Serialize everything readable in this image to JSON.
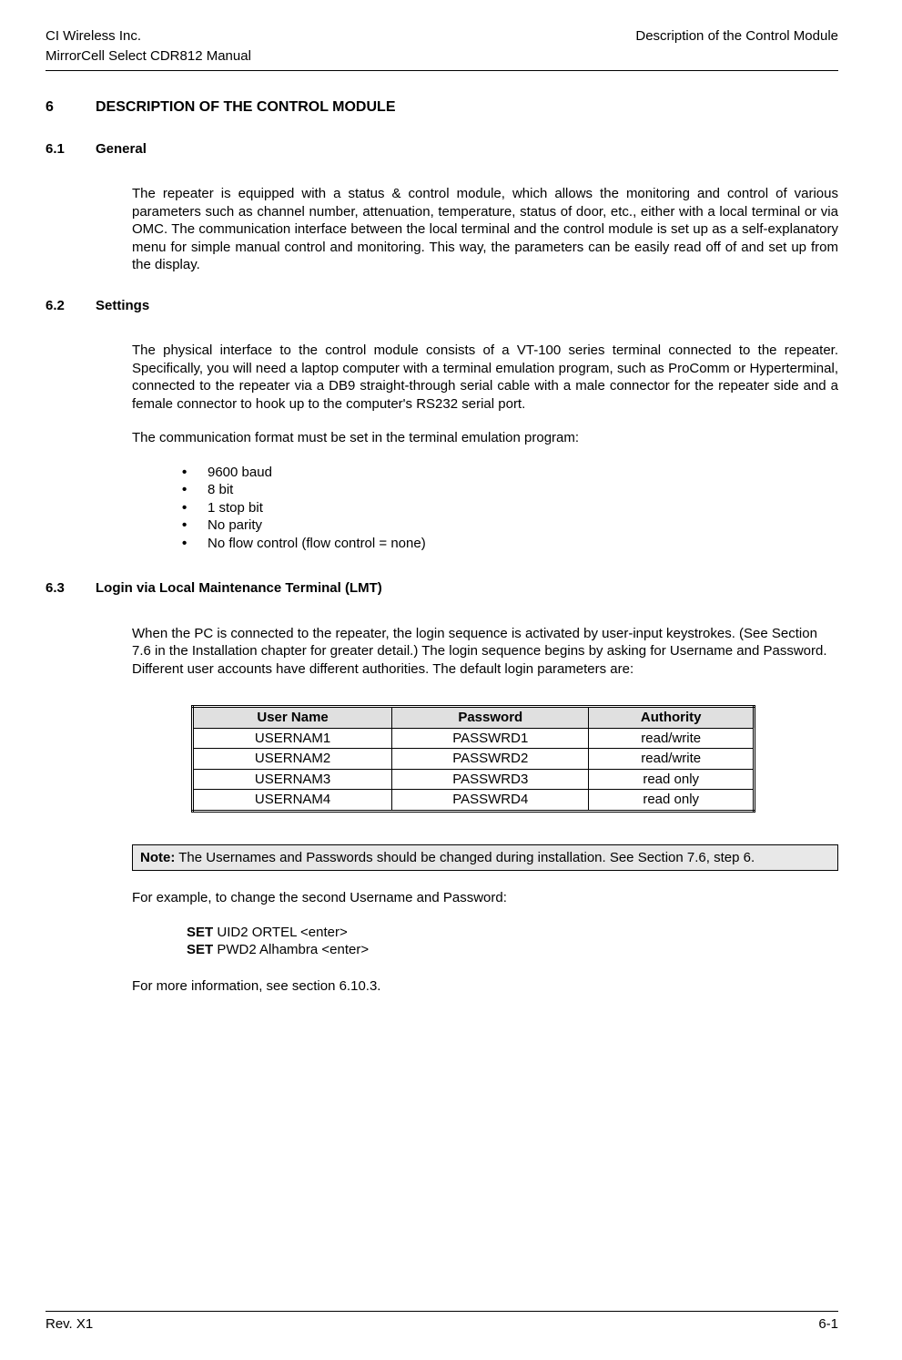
{
  "header": {
    "company": "CI Wireless Inc.",
    "manual": "MirrorCell Select CDR812 Manual",
    "section_title": "Description of the Control Module"
  },
  "s6": {
    "num": "6",
    "title": "DESCRIPTION OF THE CONTROL MODULE"
  },
  "s6_1": {
    "num": "6.1",
    "title": "General",
    "p1": "The repeater is equipped with a status & control module, which allows the monitoring and control of various parameters such as channel number, attenuation, temperature, status of door, etc., either with a local terminal or via OMC. The communication interface between the local terminal and the control module is set up as a self-explanatory menu for simple manual control and monitoring. This way, the parameters can be easily read off of and set up from the display."
  },
  "s6_2": {
    "num": "6.2",
    "title": "Settings",
    "p1": "The physical interface to the control module consists of a VT-100 series terminal connected to the repeater. Specifically, you will need a laptop computer with a terminal emulation program, such as ProComm or Hyperterminal, connected to the repeater via a DB9 straight-through serial cable with a male connector for the repeater side and a female connector to hook up to the computer's RS232 serial port.",
    "p2": "The communication format must be set in the terminal emulation program:",
    "bullets": {
      "b1": "9600 baud",
      "b2": "8 bit",
      "b3": "1 stop bit",
      "b4": "No parity",
      "b5": "No flow control (flow control = none)"
    }
  },
  "s6_3": {
    "num": "6.3",
    "title": "Login via Local Maintenance Terminal (LMT)",
    "p1": "When the PC is connected to the repeater, the login sequence is activated by user-input keystrokes. (See Section 7.6 in the Installation chapter for greater detail.) The login sequence begins by asking for Username and Password. Different user accounts have different authorities. The default login parameters are:",
    "table": {
      "h1": "User Name",
      "h2": "Password",
      "h3": "Authority",
      "r1c1": "USERNAM1",
      "r1c2": "PASSWRD1",
      "r1c3": "read/write",
      "r2c1": "USERNAM2",
      "r2c2": "PASSWRD2",
      "r2c3": "read/write",
      "r3c1": "USERNAM3",
      "r3c2": "PASSWRD3",
      "r3c3": "read only",
      "r4c1": "USERNAM4",
      "r4c2": "PASSWRD4",
      "r4c3": "read only"
    },
    "note_label": "Note:",
    "note_text": " The Usernames and Passwords should be changed during installation. See Section 7.6, step 6.",
    "p2": "For example, to change the second Username and Password:",
    "cmd1_bold": "SET",
    "cmd1_rest": " UID2 ORTEL <enter>",
    "cmd2_bold": "SET",
    "cmd2_rest": " PWD2 Alhambra <enter>",
    "p3": "For more information, see section 6.10.3."
  },
  "footer": {
    "rev": "Rev. X1",
    "page": "6-1"
  }
}
